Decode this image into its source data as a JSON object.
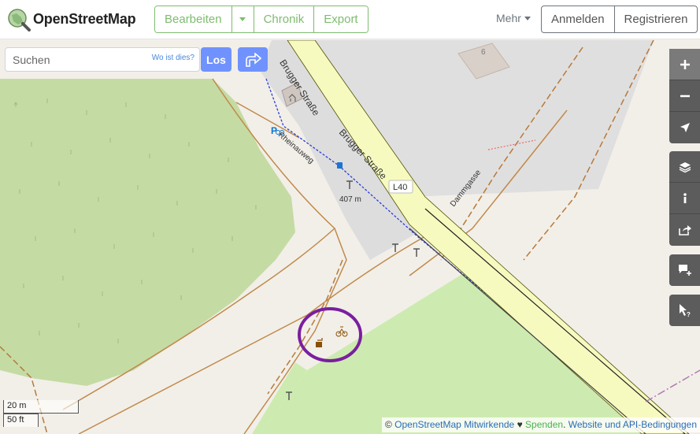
{
  "header": {
    "brand": "OpenStreetMap",
    "edit_label": "Bearbeiten",
    "history_label": "Chronik",
    "export_label": "Export",
    "more_label": "Mehr",
    "login_label": "Anmelden",
    "register_label": "Registrieren"
  },
  "search": {
    "placeholder": "Suchen",
    "where_label": "Wo ist dies?",
    "go_label": "Los"
  },
  "map": {
    "labels": {
      "brugger_strasse_top": "Brugger Straße",
      "brugger_strasse": "Brugger Straße",
      "rheinauweg": "Rheinauweg",
      "dammgasse": "Dammgasse",
      "route_ref": "L40",
      "elevation": "407 m",
      "house_number": "6"
    },
    "highlight_color": "#7a1f9e"
  },
  "controls": {
    "zoom_in": "zoom-in-icon",
    "zoom_out": "zoom-out-icon",
    "locate": "locate-icon",
    "layers": "layers-icon",
    "info": "info-icon",
    "share": "share-icon",
    "note": "note-icon",
    "query": "query-icon"
  },
  "scale": {
    "metric": "20 m",
    "imperial": "50 ft"
  },
  "attribution": {
    "copy": "©",
    "contributors": "OpenStreetMap Mitwirkende",
    "heart": "♥",
    "donate": "Spenden",
    "sep": ".",
    "terms": "Website und API-Bedingungen"
  }
}
